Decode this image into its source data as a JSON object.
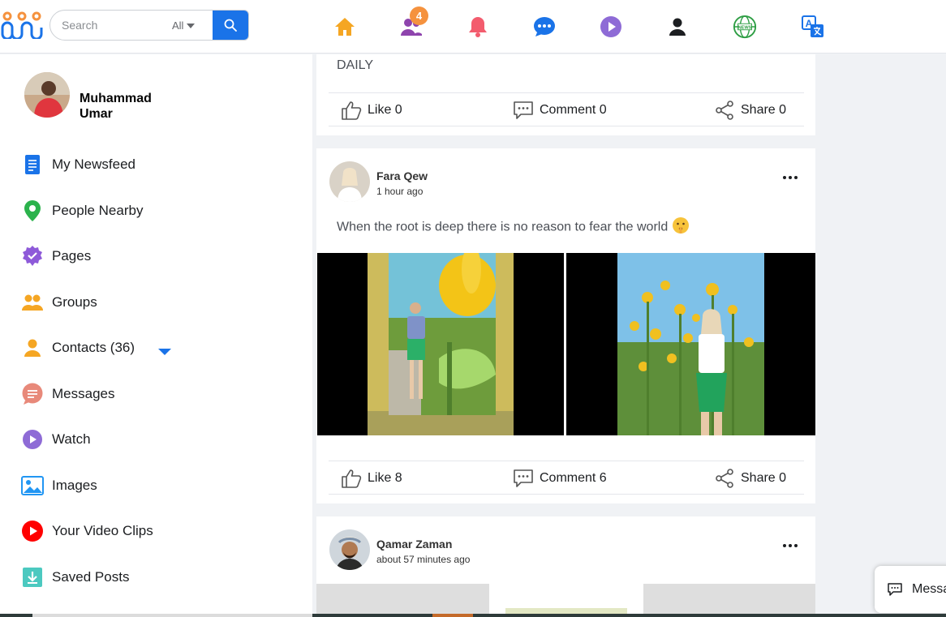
{
  "header": {
    "search_placeholder": "Search",
    "search_filter": "All",
    "friend_requests_count": "4",
    "nav_icons": [
      "home-icon",
      "friends-icon",
      "bell-icon",
      "chat-icon",
      "play-icon",
      "profile-icon",
      "news-globe-icon",
      "translate-icon"
    ]
  },
  "profile": {
    "name": "Muhammad Umar"
  },
  "sidebar": {
    "items": [
      {
        "label": "My Newsfeed",
        "icon": "newsfeed-icon"
      },
      {
        "label": "People Nearby",
        "icon": "location-pin-icon"
      },
      {
        "label": "Pages",
        "icon": "pages-badge-icon"
      },
      {
        "label": "Groups",
        "icon": "groups-icon"
      },
      {
        "label": "Contacts (36)",
        "icon": "contact-icon"
      },
      {
        "label": "Messages",
        "icon": "messages-icon"
      },
      {
        "label": "Watch",
        "icon": "watch-icon"
      },
      {
        "label": "Images",
        "icon": "images-icon"
      },
      {
        "label": "Your Video Clips",
        "icon": "video-clips-icon"
      },
      {
        "label": "Saved Posts",
        "icon": "saved-posts-icon"
      }
    ]
  },
  "posts": [
    {
      "text": "DAILY",
      "like": "Like 0",
      "comment": "Comment 0",
      "share": "Share 0"
    },
    {
      "author": "Fara Qew",
      "time": "1 hour ago",
      "text": "When the root is deep there is no reason to fear the world",
      "like": "Like 8",
      "comment": "Comment 6",
      "share": "Share 0"
    },
    {
      "author": "Qamar Zaman",
      "time": "about 57 minutes ago"
    }
  ],
  "messenger_chip": {
    "label": "Messa"
  },
  "colors": {
    "accent": "#1a73e8",
    "badge": "#f5923e",
    "background": "#f0f2f5"
  }
}
